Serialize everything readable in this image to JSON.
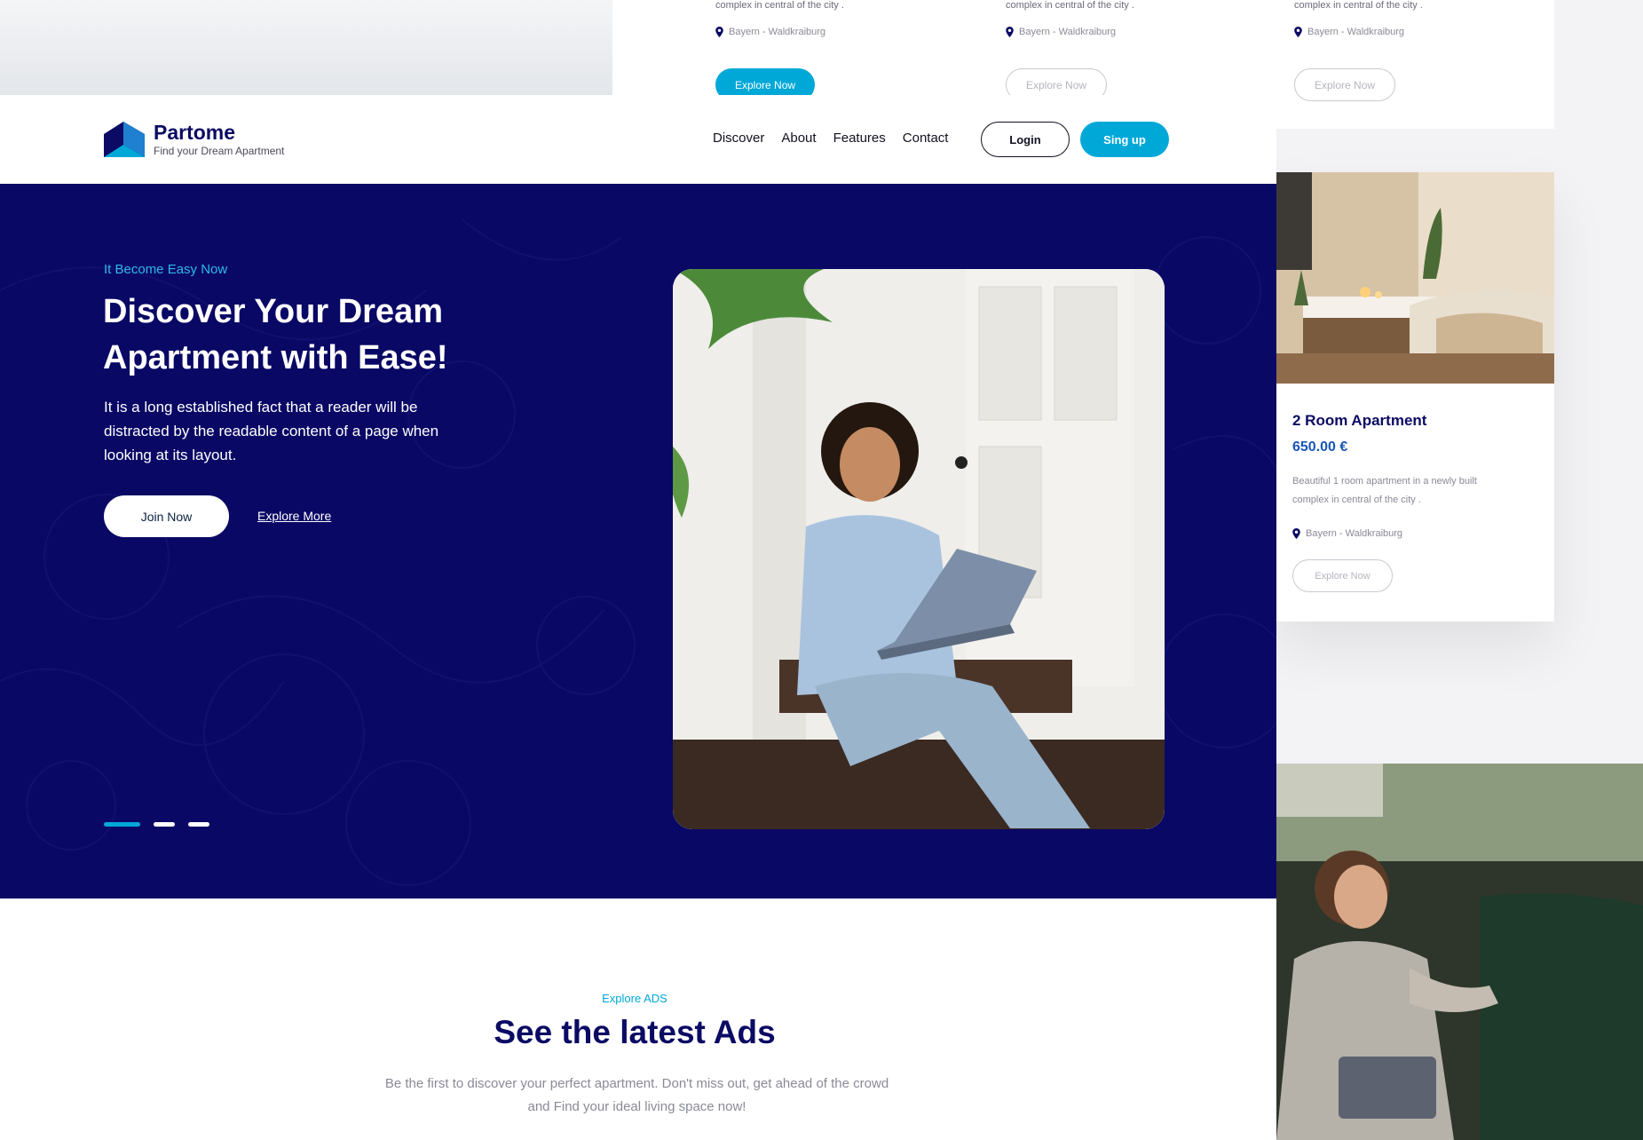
{
  "brand": {
    "name": "Partome",
    "tagline": "Find your Dream Apartment",
    "primary_color": "#0b0a64",
    "accent_color": "#00a8d8"
  },
  "nav": {
    "links": [
      "Discover",
      "About",
      "Features",
      "Contact"
    ],
    "login_label": "Login",
    "signup_label": "Sing up"
  },
  "hero": {
    "eyebrow": "It Become Easy Now",
    "title": "Discover Your Dream Apartment with Ease!",
    "text": "It is a long established fact that a reader will be distracted by the readable content of a page when looking at its layout.",
    "primary_button": "Join Now",
    "secondary_link": "Explore More",
    "slides": 3,
    "active_slide": 1,
    "background_color": "#0a0865"
  },
  "ads": {
    "eyebrow": "Explore ADS",
    "title": "See the latest Ads",
    "text": "Be the first to discover your perfect apartment. Don't miss out, get ahead of the crowd and Find your ideal living space now!"
  },
  "background_cards": [
    {
      "desc": "complex in central of the city .",
      "location": "Bayern - Waldkraiburg",
      "button": "Explore Now"
    },
    {
      "desc": "complex in central of the city .",
      "location": "Bayern - Waldkraiburg",
      "button": "Explore Now"
    },
    {
      "desc": "complex in central of the city .",
      "location": "Bayern - Waldkraiburg",
      "button": "Explore Now"
    }
  ],
  "featured_card": {
    "title": "2 Room Apartment",
    "price": "650.00 €",
    "desc": "Beautiful 1 room apartment in a newly built complex in central of the city .",
    "location": "Bayern - Waldkraiburg",
    "button": "Explore Now"
  },
  "icons": {
    "location": "map-pin-icon",
    "logo": "house-roof-logo-icon"
  }
}
